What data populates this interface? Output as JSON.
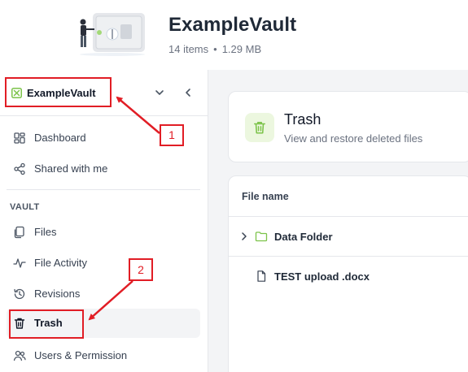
{
  "header": {
    "title": "ExampleVault",
    "item_count": "14 items",
    "separator": "•",
    "size": "1.29 MB"
  },
  "sidebar": {
    "vault_name": "ExampleVault",
    "top_items": [
      {
        "label": "Dashboard",
        "icon": "grid-icon"
      },
      {
        "label": "Shared with me",
        "icon": "share-icon"
      }
    ],
    "section_label": "VAULT",
    "vault_items": [
      {
        "label": "Files",
        "icon": "files-icon"
      },
      {
        "label": "File Activity",
        "icon": "activity-icon"
      },
      {
        "label": "Revisions",
        "icon": "history-icon"
      },
      {
        "label": "Trash",
        "icon": "trash-icon",
        "active": true
      },
      {
        "label": "Users & Permission",
        "icon": "users-icon"
      }
    ]
  },
  "page": {
    "title": "Trash",
    "subtitle": "View and restore deleted files"
  },
  "files": {
    "column_header": "File name",
    "rows": [
      {
        "name": "Data Folder",
        "type": "folder",
        "expandable": true
      },
      {
        "name": "TEST upload .docx",
        "type": "document",
        "expandable": false
      }
    ]
  },
  "annotations": {
    "callout_1": "1",
    "callout_2": "2",
    "color": "#e11d25"
  },
  "colors": {
    "accent_green": "#7cc34a",
    "active_bg": "#f3f4f6",
    "main_bg": "#f3f4f6"
  }
}
